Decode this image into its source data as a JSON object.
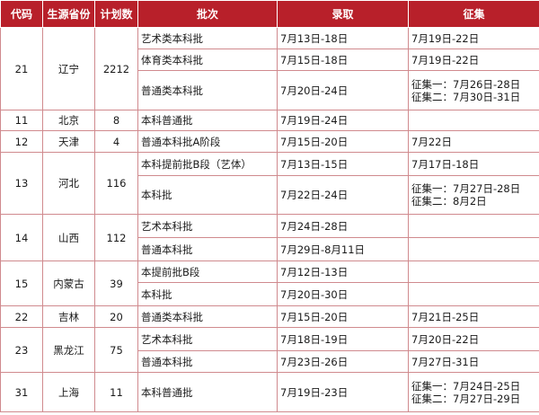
{
  "headers": {
    "code": "代码",
    "province": "生源省份",
    "plan": "计划数",
    "batch": "批次",
    "admission": "录取",
    "supplementary": "征集"
  },
  "provinces": [
    {
      "code": "21",
      "name": "辽宁",
      "plan": "2212",
      "rows": [
        {
          "batch": "艺术类本科批",
          "admission": "7月13日-18日",
          "supplementary": [
            "7月19日-22日"
          ]
        },
        {
          "batch": "体育类本科批",
          "admission": "7月15日-18日",
          "supplementary": [
            "7月19日-22日"
          ]
        },
        {
          "batch": "普通类本科批",
          "admission": "7月20日-24日",
          "supplementary": [
            "征集一：7月26日-28日",
            "征集二：7月30日-31日"
          ]
        }
      ]
    },
    {
      "code": "11",
      "name": "北京",
      "plan": "8",
      "rows": [
        {
          "batch": "本科普通批",
          "admission": "7月19日-24日",
          "supplementary": []
        }
      ]
    },
    {
      "code": "12",
      "name": "天津",
      "plan": "4",
      "rows": [
        {
          "batch": "普通本科批A阶段",
          "admission": "7月15日-20日",
          "supplementary": [
            "7月22日"
          ]
        }
      ]
    },
    {
      "code": "13",
      "name": "河北",
      "plan": "116",
      "rows": [
        {
          "batch": "本科提前批B段（艺体）",
          "admission": "7月13日-15日",
          "supplementary": [
            "7月17日-18日"
          ]
        },
        {
          "batch": "本科批",
          "admission": "7月22日-24日",
          "supplementary": [
            "征集一：7月27日-28日",
            "征集二：8月2日"
          ]
        }
      ]
    },
    {
      "code": "14",
      "name": "山西",
      "plan": "112",
      "rows": [
        {
          "batch": "艺术本科批",
          "admission": "7月24日-28日",
          "supplementary": []
        },
        {
          "batch": "普通本科批",
          "admission": "7月29日-8月11日",
          "supplementary": []
        }
      ]
    },
    {
      "code": "15",
      "name": "内蒙古",
      "plan": "39",
      "rows": [
        {
          "batch": "本提前批B段",
          "admission": "7月12日-13日",
          "supplementary": []
        },
        {
          "batch": "本科批",
          "admission": "7月20日-30日",
          "supplementary": []
        }
      ]
    },
    {
      "code": "22",
      "name": "吉林",
      "plan": "20",
      "rows": [
        {
          "batch": "普通类本科批",
          "admission": "7月15日-20日",
          "supplementary": [
            "7月21日-25日"
          ]
        }
      ]
    },
    {
      "code": "23",
      "name": "黑龙江",
      "plan": "75",
      "rows": [
        {
          "batch": "艺术本科批",
          "admission": "7月18日-19日",
          "supplementary": [
            "7月20日-22日"
          ]
        },
        {
          "batch": "普通本科批",
          "admission": "7月23日-26日",
          "supplementary": [
            "7月27日-31日"
          ]
        }
      ]
    },
    {
      "code": "31",
      "name": "上海",
      "plan": "11",
      "rows": [
        {
          "batch": "本科普通批",
          "admission": "7月19日-23日",
          "supplementary": [
            "征集一：7月24日-25日",
            "征集二：7月27日-29日"
          ]
        }
      ]
    }
  ]
}
